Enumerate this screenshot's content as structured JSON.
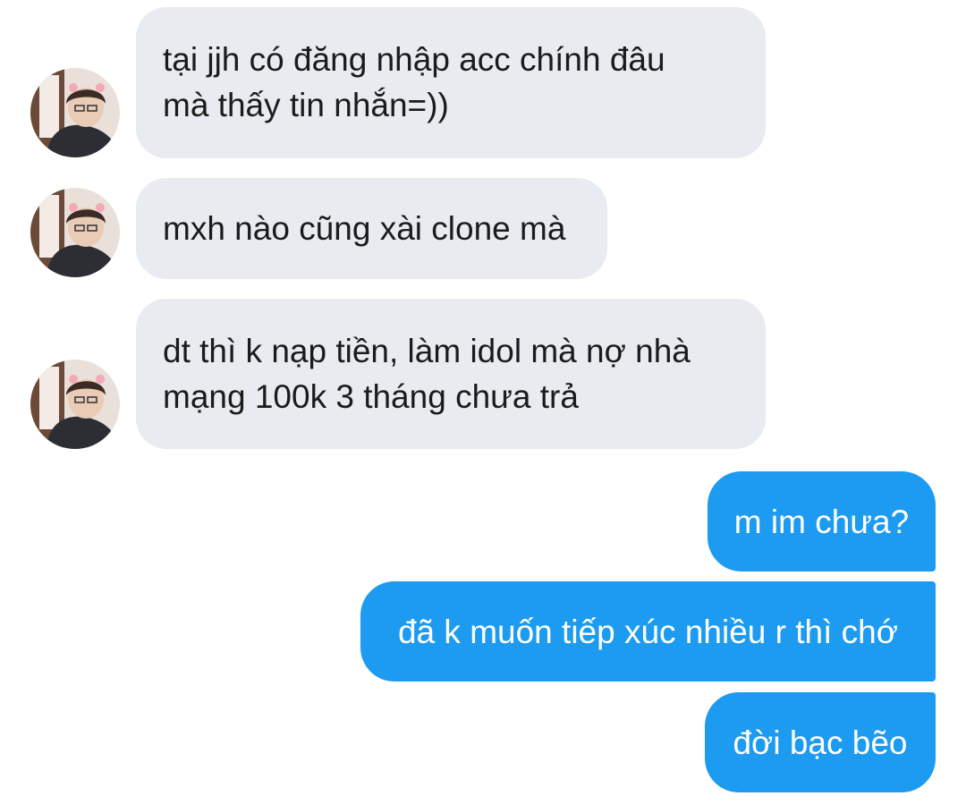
{
  "conversation": {
    "incoming": [
      {
        "lines": [
          "tại jjh có đăng nhập acc chính đâu",
          "mà thấy tin nhắn=))"
        ],
        "avatar_icon": "contact-avatar-photo"
      },
      {
        "lines": [
          "mxh nào cũng xài clone mà"
        ],
        "avatar_icon": "contact-avatar-photo"
      },
      {
        "lines": [
          "dt thì k nạp tiền, làm idol mà nợ nhà",
          "mạng 100k 3 tháng chưa trả"
        ],
        "avatar_icon": "contact-avatar-photo"
      }
    ],
    "outgoing": [
      {
        "lines": [
          "m im chưa?"
        ]
      },
      {
        "lines": [
          "đã k muốn tiếp xúc nhiều r thì chớ"
        ]
      },
      {
        "lines": [
          "đời bạc bẽo"
        ]
      }
    ]
  },
  "colors": {
    "incoming_bubble": "#e8ecf0",
    "outgoing_bubble": "#1d9bf0",
    "incoming_text": "#1b1b1b",
    "outgoing_text": "#ffffff",
    "background": "#ffffff"
  }
}
